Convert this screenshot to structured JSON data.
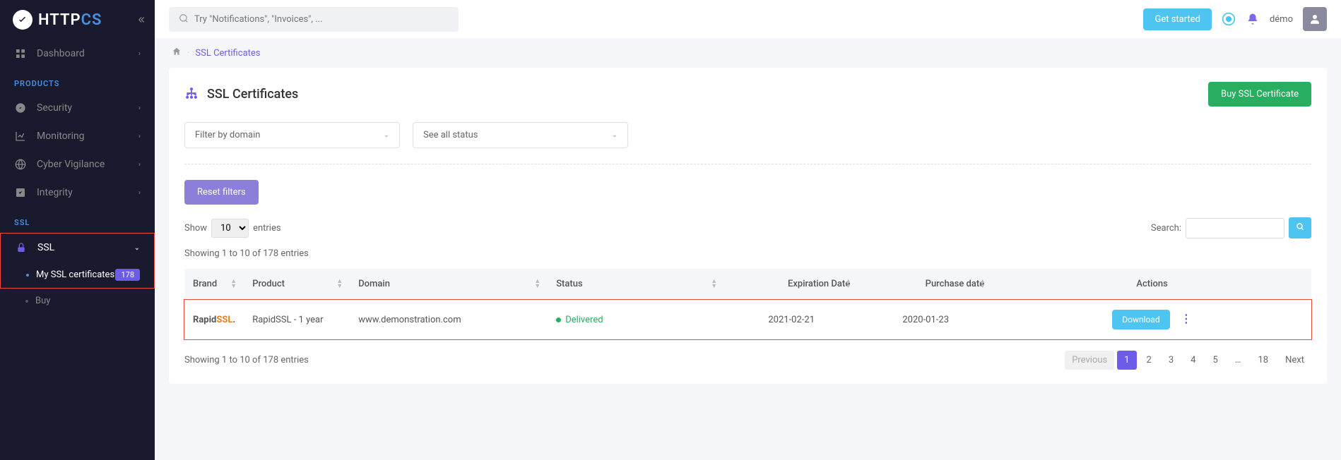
{
  "logo": {
    "text1": "HTTP",
    "text2": "CS"
  },
  "sidebar": {
    "dashboard": "Dashboard",
    "products_label": "PRODUCTS",
    "security": "Security",
    "monitoring": "Monitoring",
    "cyber": "Cyber Vigilance",
    "integrity": "Integrity",
    "ssl_label": "SSL",
    "ssl": "SSL",
    "my_certs": "My SSL certificates",
    "my_certs_badge": "178",
    "buy": "Buy"
  },
  "topbar": {
    "search_placeholder": "Try \"Notifications\", \"Invoices\", ...",
    "get_started": "Get started",
    "user": "démo"
  },
  "breadcrumb": {
    "item": "SSL Certificates"
  },
  "page": {
    "title": "SSL Certificates",
    "buy_btn": "Buy SSL Certificate",
    "filter_domain": "Filter by domain",
    "filter_status": "See all status",
    "reset": "Reset filters",
    "show": "Show",
    "entries": "entries",
    "entries_value": "10",
    "search_label": "Search:",
    "info": "Showing 1 to 10 of 178 entries"
  },
  "table": {
    "headers": {
      "brand": "Brand",
      "product": "Product",
      "domain": "Domain",
      "status": "Status",
      "expiration": "Expiration Date",
      "purchase": "Purchase date",
      "actions": "Actions"
    },
    "row": {
      "brand1": "Rapid",
      "brand2": "SSL",
      "brand3": ".",
      "product": "RapidSSL - 1 year",
      "domain": "www.demonstration.com",
      "status": "Delivered",
      "expiration": "2021-02-21",
      "purchase": "2020-01-23",
      "download": "Download"
    }
  },
  "pagination": {
    "prev": "Previous",
    "p1": "1",
    "p2": "2",
    "p3": "3",
    "p4": "4",
    "p5": "5",
    "ellipsis": "…",
    "last": "18",
    "next": "Next"
  }
}
